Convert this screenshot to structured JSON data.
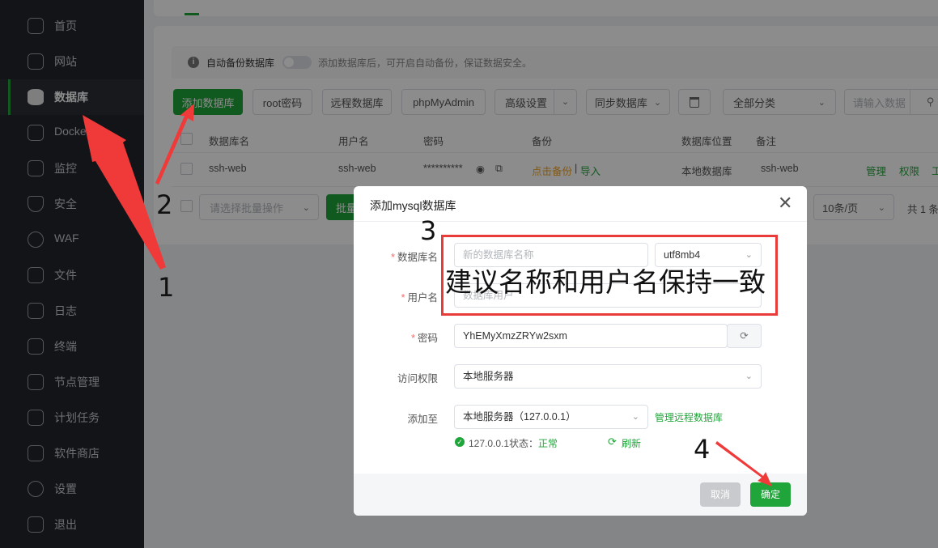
{
  "sidebar": {
    "items": [
      {
        "label": "首页",
        "icon": "home-icon"
      },
      {
        "label": "网站",
        "icon": "website-icon"
      },
      {
        "label": "数据库",
        "icon": "database-icon"
      },
      {
        "label": "Docker",
        "icon": "docker-icon"
      },
      {
        "label": "监控",
        "icon": "monitor-icon"
      },
      {
        "label": "安全",
        "icon": "shield-icon"
      },
      {
        "label": "WAF",
        "icon": "waf-icon"
      },
      {
        "label": "文件",
        "icon": "folder-icon"
      },
      {
        "label": "日志",
        "icon": "log-icon"
      },
      {
        "label": "终端",
        "icon": "terminal-icon"
      },
      {
        "label": "节点管理",
        "icon": "node-icon"
      },
      {
        "label": "计划任务",
        "icon": "calendar-icon"
      },
      {
        "label": "软件商店",
        "icon": "apps-icon"
      },
      {
        "label": "设置",
        "icon": "settings-icon"
      },
      {
        "label": "退出",
        "icon": "logout-icon"
      }
    ]
  },
  "tip": {
    "label": "自动备份数据库",
    "text": "添加数据库后，可开启自动备份，保证数据安全。"
  },
  "toolbar": {
    "add": "添加数据库",
    "root_pwd": "root密码",
    "remote": "远程数据库",
    "phpmyadmin": "phpMyAdmin",
    "advanced": "高级设置",
    "sync": "同步数据库",
    "category": "全部分类",
    "search_placeholder": "请输入数据"
  },
  "table": {
    "headers": {
      "name": "数据库名",
      "user": "用户名",
      "password": "密码",
      "backup": "备份",
      "location": "数据库位置",
      "remark": "备注"
    },
    "rows": [
      {
        "name": "ssh-web",
        "user": "ssh-web",
        "password": "**********",
        "backup_link": "点击备份",
        "sep": "|",
        "import": "导入",
        "location": "本地数据库",
        "remark": "ssh-web",
        "manage": "管理",
        "perm": "权限",
        "more": "工"
      }
    ],
    "batch_placeholder": "请选择批量操作",
    "batch_btn": "批量",
    "page_size": "10条/页",
    "total": "共 1 条"
  },
  "dialog": {
    "title": "添加mysql数据库",
    "db_name_label": "数据库名",
    "db_name_placeholder": "新的数据库名称",
    "charset": "utf8mb4",
    "user_label": "用户名",
    "user_placeholder": "数据库用户",
    "pwd_label": "密码",
    "pwd_value": "YhEMyXmzZRYw2sxm",
    "access_label": "访问权限",
    "access_value": "本地服务器",
    "addto_label": "添加至",
    "addto_value": "本地服务器（127.0.0.1）",
    "manage_remote": "管理远程数据库",
    "status_prefix": "127.0.0.1状态：",
    "status_value": "正常",
    "refresh": "刷新",
    "cancel": "取消",
    "confirm": "确定"
  },
  "annotations": {
    "hint": "建议名称和用户名保持一致",
    "n1": "1",
    "n2": "2",
    "n3": "3",
    "n4": "4"
  },
  "colors": {
    "accent": "#20a53a",
    "sidebar": "#23262b",
    "annotation": "#ea3b3b"
  }
}
